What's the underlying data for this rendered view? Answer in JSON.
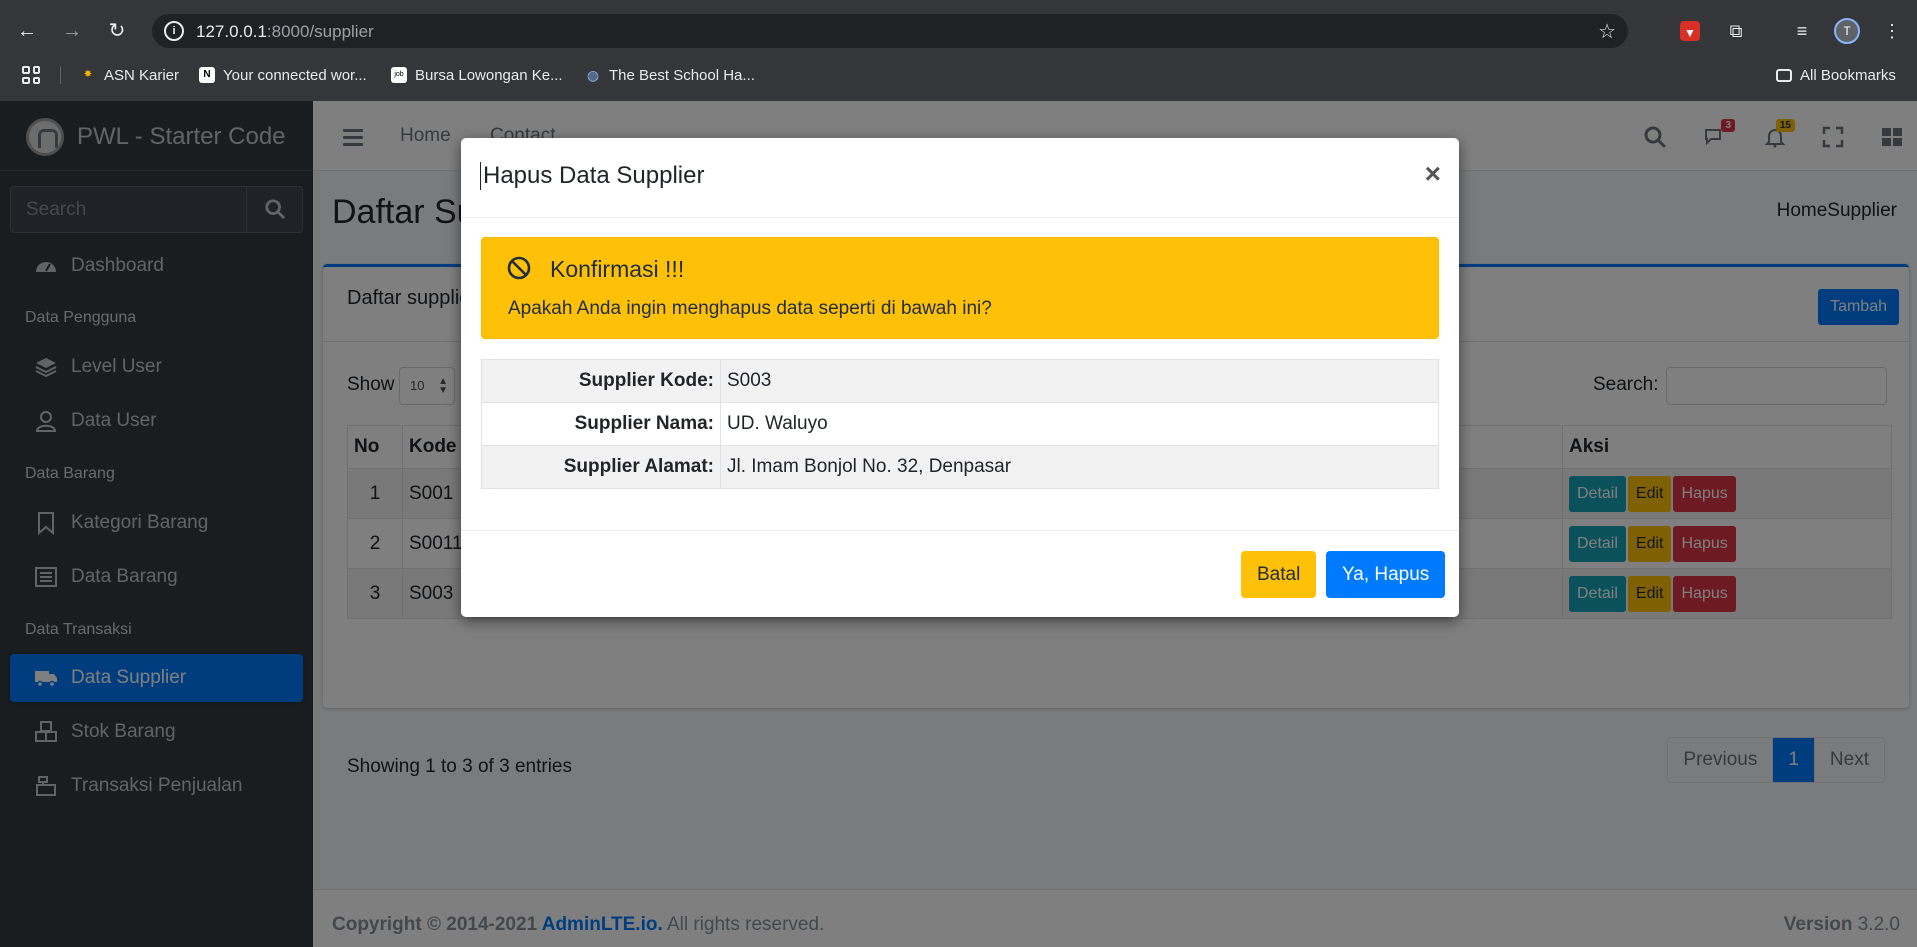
{
  "browser": {
    "url_host": "127.0.0.1",
    "url_path": ":8000/supplier",
    "profile_initial": "T",
    "bookmarks": [
      {
        "label": "ASN Karier",
        "icon": "asn-icon"
      },
      {
        "label": "Your connected wor...",
        "icon": "notion-icon"
      },
      {
        "label": "Bursa Lowongan Ke...",
        "icon": "jobid-icon"
      },
      {
        "label": "The Best School Ha...",
        "icon": "globe-icon"
      }
    ],
    "all_bookmarks": "All Bookmarks"
  },
  "brand": {
    "name": "PWL - Starter Code"
  },
  "sidebar": {
    "search_placeholder": "Search",
    "dashboard": "Dashboard",
    "header_pengguna": "Data Pengguna",
    "level_user": "Level User",
    "data_user": "Data User",
    "header_barang": "Data Barang",
    "kategori_barang": "Kategori Barang",
    "data_barang": "Data Barang",
    "header_transaksi": "Data Transaksi",
    "data_supplier": "Data Supplier",
    "stok_barang": "Stok Barang",
    "transaksi_penjualan": "Transaksi Penjualan"
  },
  "topnav": {
    "home": "Home",
    "contact": "Contact",
    "messages_count": "3",
    "notifications_count": "15",
    "colors": {
      "danger": "#dc3545",
      "warning": "#ffc107"
    }
  },
  "content": {
    "title": "Daftar Supplier",
    "breadcrumb": "HomeSupplier",
    "card_title": "Daftar supplier",
    "tambah": "Tambah",
    "show_label": "Show",
    "show_value": "10",
    "search_label": "Search:",
    "table": {
      "headers": [
        "No",
        "Kode",
        "Aksi"
      ],
      "rows": [
        {
          "no": "1",
          "kode": "S001"
        },
        {
          "no": "2",
          "kode": "S0011"
        },
        {
          "no": "3",
          "kode": "S003"
        }
      ],
      "actions": {
        "detail": "Detail",
        "edit": "Edit",
        "hapus": "Hapus"
      }
    },
    "entries": "Showing 1 to 3 of 3 entries",
    "pager": {
      "previous": "Previous",
      "current": "1",
      "next": "Next"
    }
  },
  "footer": {
    "copyright": "Copyright © 2014-2021 ",
    "link": "AdminLTE.io.",
    "rights": " All rights reserved.",
    "version_label": "Version",
    "version": "3.2.0"
  },
  "modal": {
    "title": "Hapus Data Supplier",
    "close": "×",
    "alert_title": "Konfirmasi !!!",
    "alert_text": "Apakah Anda ingin menghapus data seperti di bawah ini?",
    "fields": [
      {
        "label": "Supplier Kode:",
        "value": "S003"
      },
      {
        "label": "Supplier Nama:",
        "value": "UD. Waluyo"
      },
      {
        "label": "Supplier Alamat:",
        "value": "Jl. Imam Bonjol No. 32, Denpasar"
      }
    ],
    "batal": "Batal",
    "confirm": "Ya, Hapus"
  },
  "colors": {
    "primary": "#007bff",
    "warning": "#ffc107",
    "info": "#17a2b8",
    "danger": "#dc3545",
    "sidebar": "#343a40"
  }
}
